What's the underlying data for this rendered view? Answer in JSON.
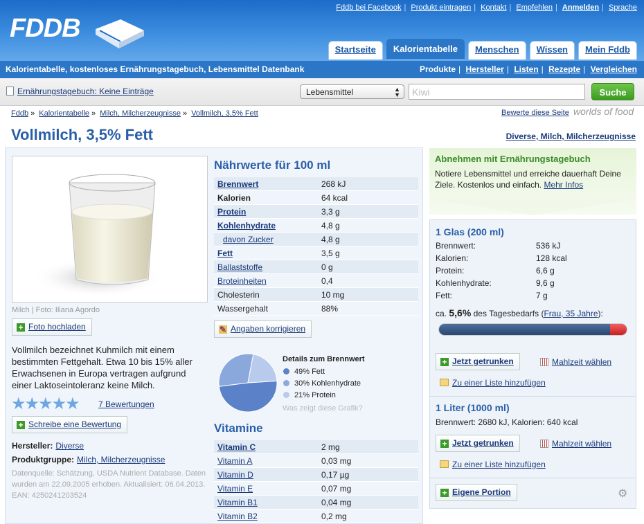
{
  "header": {
    "logo": "FDDB",
    "topnav": [
      "Fddb bei Facebook",
      "Produkt eintragen",
      "Kontakt",
      "Empfehlen",
      "Anmelden",
      "Sprache"
    ],
    "tabs": [
      "Startseite",
      "Kalorientabelle",
      "Menschen",
      "Wissen",
      "Mein Fddb"
    ],
    "tagline": "Kalorientabelle, kostenloses Ernährungstagebuch, Lebensmittel Datenbank",
    "subnav": [
      "Produkte",
      "Hersteller",
      "Listen",
      "Rezepte",
      "Vergleichen"
    ]
  },
  "search": {
    "diary": "Ernährungstagebuch: Keine Einträge",
    "category": "Lebensmittel",
    "placeholder": "Kiwi",
    "button": "Suche"
  },
  "breadcrumb": [
    "Fddb",
    "Kalorientabelle",
    "Milch, Milcherzeugnisse",
    "Vollmilch, 3,5% Fett"
  ],
  "rate": "Bewerte diese Seite",
  "worlds": "worlds of food",
  "title": "Vollmilch, 3,5% Fett",
  "categories": "Diverse, Milch, Milcherzeugnisse",
  "photo": {
    "caption": "Milch | Foto: Iliana Agordo",
    "upload": "Foto hochladen"
  },
  "description": "Vollmilch bezeichnet Kuhmilch mit einem bestimmten Fettgehalt. Etwa 10 bis 15% aller Erwachsenen in Europa vertragen aufgrund einer Laktoseintoleranz keine Milch.",
  "rating": {
    "stars": "★★★★★",
    "reviews": "7 Bewertungen",
    "write": "Schreibe eine Bewertung"
  },
  "manufacturer": {
    "label": "Hersteller:",
    "value": "Diverse"
  },
  "group": {
    "label": "Produktgruppe:",
    "value": "Milch, Milcherzeugnisse"
  },
  "source": "Datenquelle: Schätzung, USDA Nutrient Database. Daten wurden am 22.09.2005 erhoben. Aktualisiert: 06.04.2013. EAN: 4250241203524",
  "nutrition": {
    "title": "Nährwerte für 100 ml",
    "rows": [
      [
        "Brennwert",
        "268 kJ"
      ],
      [
        "Kalorien",
        "64 kcal"
      ],
      [
        "Protein",
        "3,3 g"
      ],
      [
        "Kohlenhydrate",
        "4,8 g"
      ],
      [
        "davon Zucker",
        "4,8 g"
      ],
      [
        "Fett",
        "3,5 g"
      ],
      [
        "Ballaststoffe",
        "0 g"
      ],
      [
        "Broteinheiten",
        "0,4"
      ],
      [
        "Cholesterin",
        "10 mg"
      ],
      [
        "Wassergehalt",
        "88%"
      ]
    ],
    "correct": "Angaben korrigieren"
  },
  "pie": {
    "title": "Details zum Brennwert",
    "items": [
      {
        "label": "49% Fett",
        "value": 49,
        "color": "#5b82c8"
      },
      {
        "label": "30% Kohlenhydrate",
        "value": 30,
        "color": "#8aa8dc"
      },
      {
        "label": "21% Protein",
        "value": 21,
        "color": "#b8cbec"
      }
    ],
    "question": "Was zeigt diese Grafik?"
  },
  "vitamins": {
    "title": "Vitamine",
    "rows": [
      [
        "Vitamin C",
        "2 mg"
      ],
      [
        "Vitamin A",
        "0,03 mg"
      ],
      [
        "Vitamin D",
        "0,17 µg"
      ],
      [
        "Vitamin E",
        "0,07 mg"
      ],
      [
        "Vitamin B1",
        "0,04 mg"
      ],
      [
        "Vitamin B2",
        "0,2 mg"
      ]
    ]
  },
  "promo": {
    "title": "Abnehmen mit Ernährungstagebuch",
    "text": "Notiere Lebensmittel und erreiche dauerhaft Deine Ziele. Kostenlos und einfach.",
    "link": "Mehr Infos"
  },
  "serving1": {
    "title": "1 Glas (200 ml)",
    "rows": [
      [
        "Brennwert:",
        "536 kJ"
      ],
      [
        "Kalorien:",
        "128 kcal"
      ],
      [
        "Protein:",
        "6,6 g"
      ],
      [
        "Kohlenhydrate:",
        "9,6 g"
      ],
      [
        "Fett:",
        "7 g"
      ]
    ],
    "need_pre": "ca.",
    "need_pct": "5,6%",
    "need_mid": "des Tagesbedarfs (",
    "need_link": "Frau, 35 Jahre",
    "need_post": "):",
    "progress": 0.056
  },
  "serving2": {
    "title": "1 Liter (1000 ml)",
    "summary": "Brennwert: 2680 kJ, Kalorien: 640 kcal"
  },
  "actions": {
    "drunk": "Jetzt getrunken",
    "meal": "Mahlzeit wählen",
    "list": "Zu einer Liste hinzufügen",
    "own": "Eigene Portion"
  }
}
